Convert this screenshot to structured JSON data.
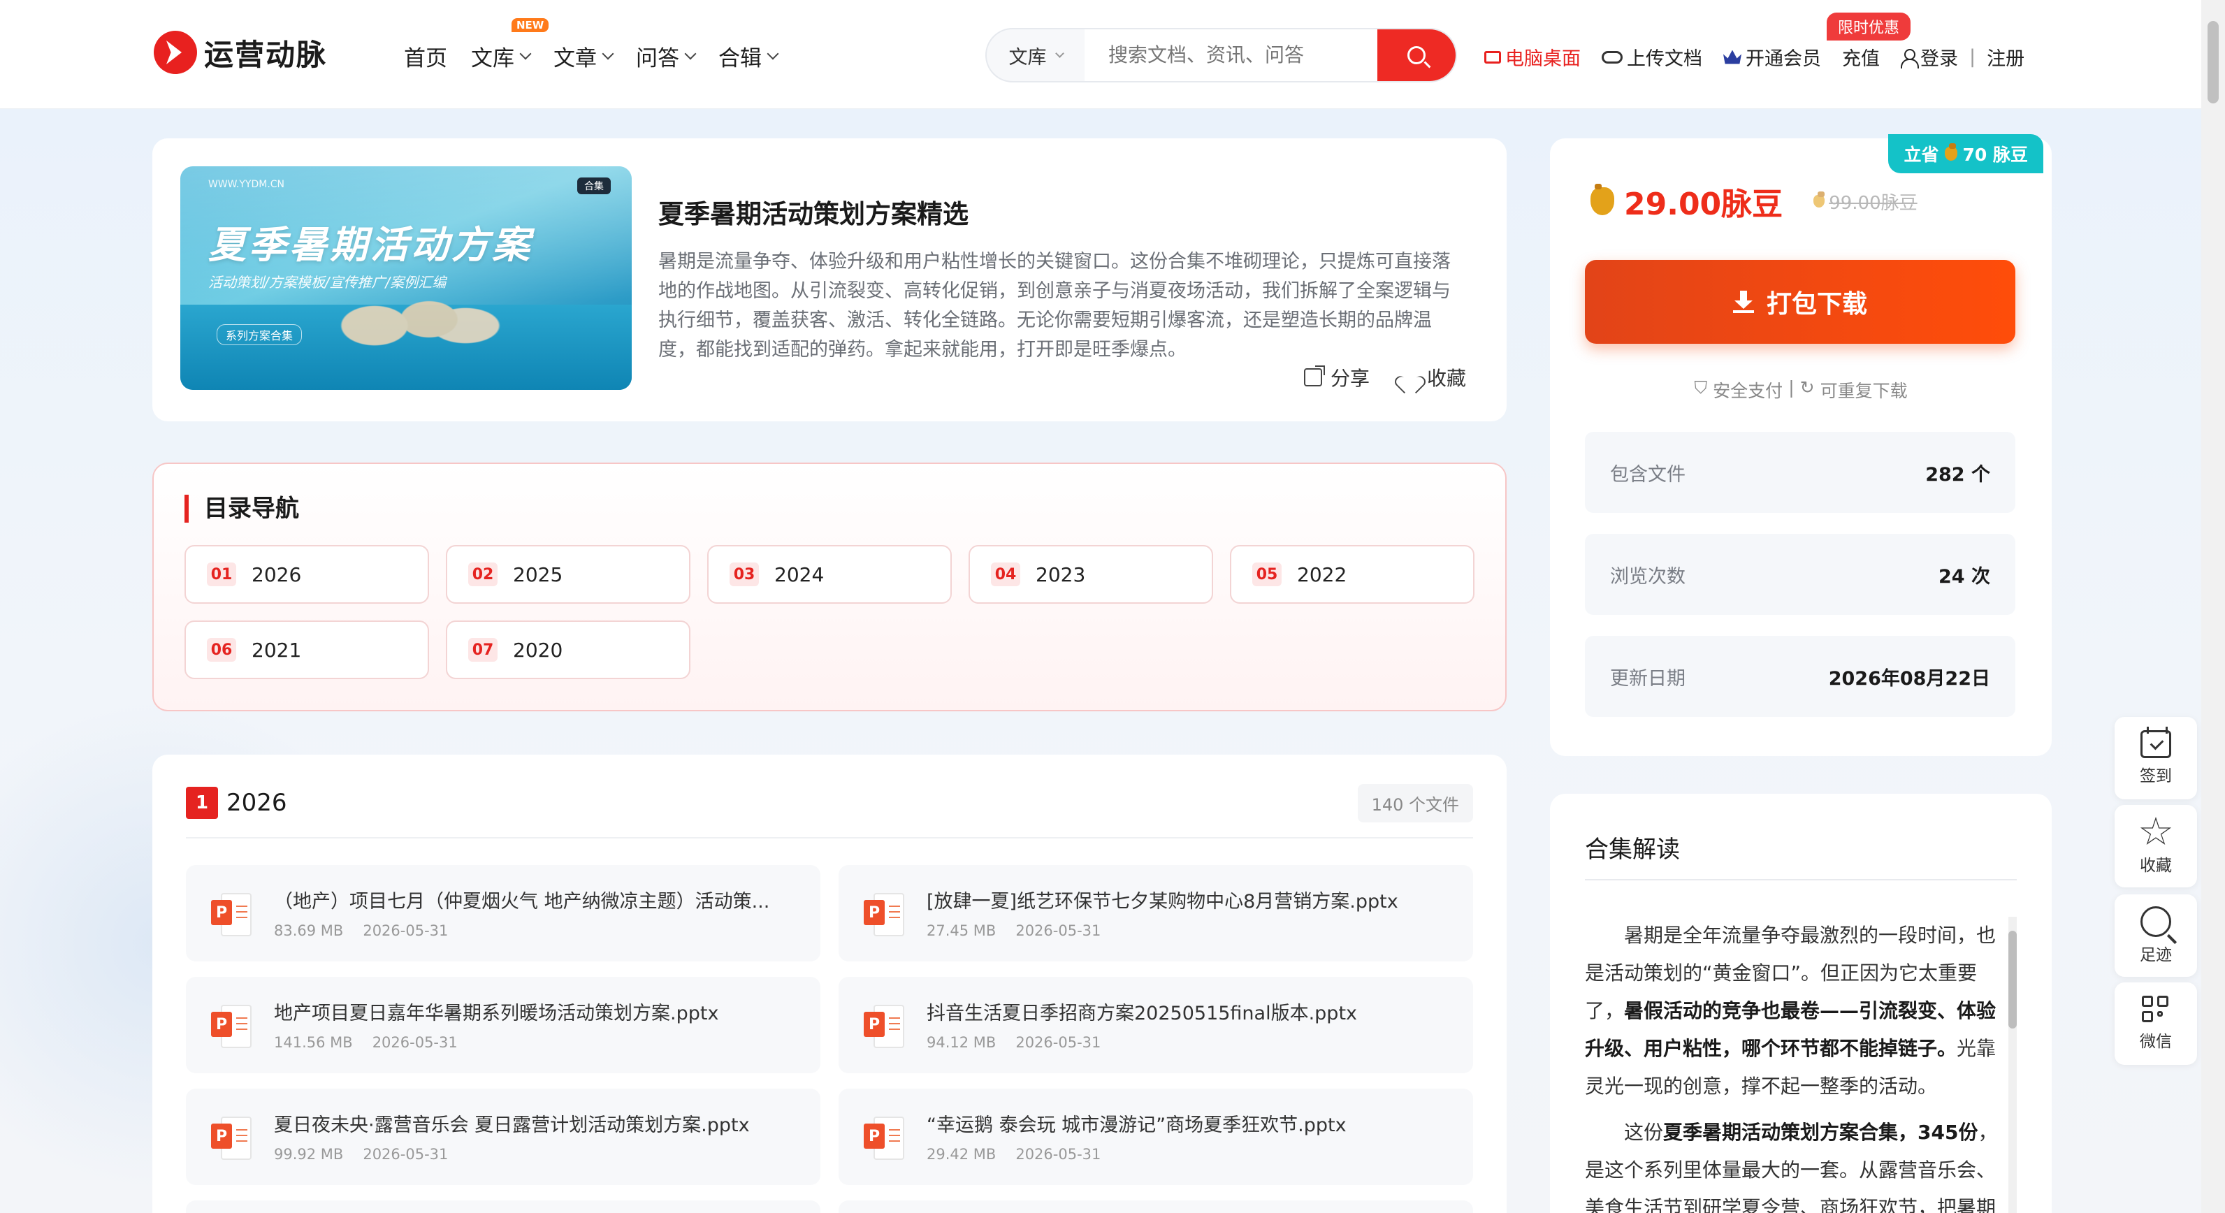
{
  "header": {
    "logo_text": "运营动脉",
    "nav": [
      {
        "label": "首页",
        "dropdown": false
      },
      {
        "label": "文库",
        "dropdown": true,
        "badge": "NEW"
      },
      {
        "label": "文章",
        "dropdown": true
      },
      {
        "label": "问答",
        "dropdown": true
      },
      {
        "label": "合辑",
        "dropdown": true
      }
    ],
    "search": {
      "category": "文库",
      "placeholder": "搜索文档、资讯、问答"
    },
    "links": {
      "desktop": "电脑桌面",
      "upload": "上传文档",
      "vip": "开通会员",
      "recharge": "充值",
      "login": "登录",
      "separator": "|",
      "register": "注册",
      "promo": "限时优惠"
    }
  },
  "hero": {
    "cover": {
      "url": "WWW.YYDM.CN",
      "badge": "合集",
      "title": "夏季暑期活动方案",
      "subtitle": "活动策划/方案模板/宣传推广/案例汇编",
      "tag": "系列方案合集"
    },
    "title": "夏季暑期活动策划方案精选",
    "description": "暑期是流量争夺、体验升级和用户粘性增长的关键窗口。这份合集不堆砌理论，只提炼可直接落地的作战地图。从引流裂变、高转化促销，到创意亲子与消夏夜场活动，我们拆解了全案逻辑与执行细节，覆盖获客、激活、转化全链路。无论你需要短期引爆客流，还是塑造长期的品牌温度，都能找到适配的弹药。拿起来就能用，打开即是旺季爆点。",
    "share": "分享",
    "favorite": "收藏"
  },
  "toc": {
    "title": "目录导航",
    "items": [
      {
        "num": "01",
        "label": "2026"
      },
      {
        "num": "02",
        "label": "2025"
      },
      {
        "num": "03",
        "label": "2024"
      },
      {
        "num": "04",
        "label": "2023"
      },
      {
        "num": "05",
        "label": "2022"
      },
      {
        "num": "06",
        "label": "2021"
      },
      {
        "num": "07",
        "label": "2020"
      }
    ]
  },
  "section": {
    "num": "1",
    "title": "2026",
    "count": "140 个文件",
    "file_icon_label": "P",
    "files": [
      {
        "name": "（地产）项目七月（仲夏烟火气 地产纳微凉主题）活动策...",
        "size": "83.69 MB",
        "date": "2026-05-31"
      },
      {
        "name": "[放肆一夏]纸艺环保节七夕某购物中心8月营销方案.pptx",
        "size": "27.45 MB",
        "date": "2026-05-31"
      },
      {
        "name": "地产项目夏日嘉年华暑期系列暖场活动策划方案.pptx",
        "size": "141.56 MB",
        "date": "2026-05-31"
      },
      {
        "name": "抖音生活夏日季招商方案20250515final版本.pptx",
        "size": "94.12 MB",
        "date": "2026-05-31"
      },
      {
        "name": "夏日夜未央·露营音乐会 夏日露营计划活动策划方案.pptx",
        "size": "99.92 MB",
        "date": "2026-05-31"
      },
      {
        "name": "“幸运鹅 泰会玩 城市漫游记”商场夏季狂欢节.pptx",
        "size": "29.42 MB",
        "date": "2026-05-31"
      }
    ]
  },
  "purchase": {
    "save_badge": "立省",
    "save_amount": "70 脉豆",
    "price": "29.00脉豆",
    "original_price": "99.00脉豆",
    "download_label": "打包下载",
    "secure_pay": "安全支付",
    "separator": "|",
    "repeat_download": "可重复下载",
    "stats": [
      {
        "key": "包含文件",
        "value": "282 个"
      },
      {
        "key": "浏览次数",
        "value": "24 次"
      },
      {
        "key": "更新日期",
        "value": "2026年08月22日"
      }
    ]
  },
  "interpretation": {
    "title": "合集解读",
    "p1_a": "暑期是全年流量争夺最激烈的一段时间，也是活动策划的“黄金窗口”。但正因为它太重要了，",
    "p1_b": "暑假活动的竞争也最卷——引流裂变、体验升级、用户粘性，哪个环节都不能掉链子。",
    "p1_c": "光靠灵光一现的创意，撑不起一整季的活动。",
    "p2_a": "这份",
    "p2_b": "夏季暑期活动策划方案合集，345份",
    "p2_c": "，是这个系列里体量最大的一套。从露营音乐会、美食生活节到研学夏令营、商场狂欢节，把暑期"
  },
  "float_bar": [
    {
      "label": "签到",
      "icon": "calendar-check-icon"
    },
    {
      "label": "收藏",
      "icon": "star-icon"
    },
    {
      "label": "足迹",
      "icon": "footprint-icon"
    },
    {
      "label": "微信",
      "icon": "qrcode-icon"
    }
  ]
}
